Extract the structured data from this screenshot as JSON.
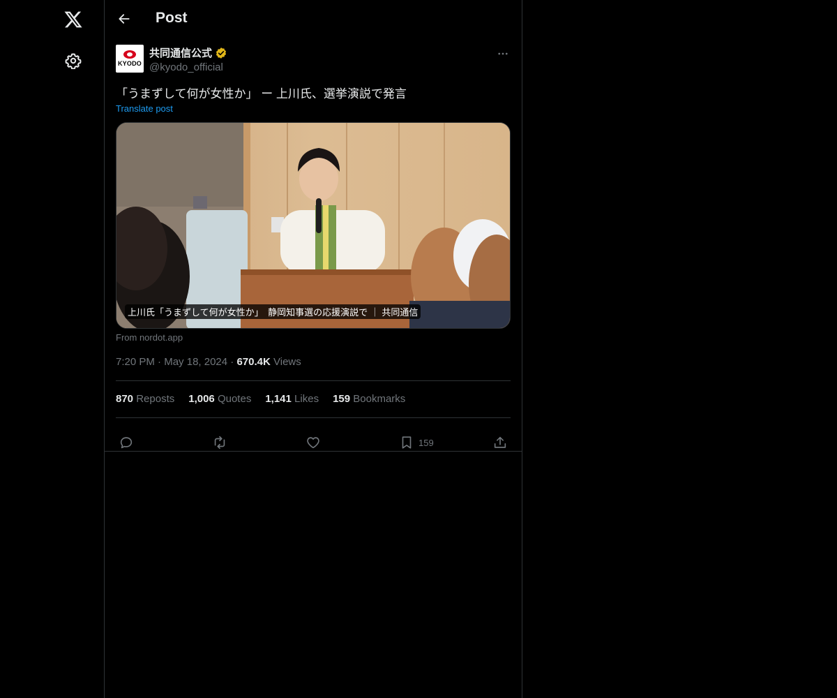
{
  "header": {
    "title": "Post"
  },
  "post": {
    "author_name": "共同通信公式",
    "handle": "@kyodo_official",
    "avatar_text": "KYODO",
    "text": "「うまずして何が女性か」 ー 上川氏、選挙演説で発言",
    "translate_label": "Translate post",
    "card": {
      "caption": "上川氏「うまずして何が女性か」　静岡知事選の応援演説で ｜ 共同通信",
      "source": "From nordot.app"
    },
    "time": "7:20 PM",
    "date": "May 18, 2024",
    "views_count": "670.4K",
    "views_label": "Views",
    "stats": {
      "reposts_count": "870",
      "reposts_label": "Reposts",
      "quotes_count": "1,006",
      "quotes_label": "Quotes",
      "likes_count": "1,141",
      "likes_label": "Likes",
      "bookmarks_count": "159",
      "bookmarks_label": "Bookmarks"
    },
    "actions": {
      "bookmark_count": "159"
    }
  },
  "icons": {
    "logo": "x-logo-icon",
    "settings": "gear-icon",
    "back": "arrow-left-icon",
    "verified": "verified-badge-icon",
    "more": "more-horizontal-icon",
    "reply": "reply-icon",
    "repost": "repost-icon",
    "like": "heart-icon",
    "bookmark": "bookmark-icon",
    "share": "share-icon"
  },
  "colors": {
    "background": "#000000",
    "text": "#e7e9ea",
    "muted": "#71767b",
    "link": "#1d9bf0",
    "verified": "#e2b719",
    "border": "#2f3336"
  }
}
